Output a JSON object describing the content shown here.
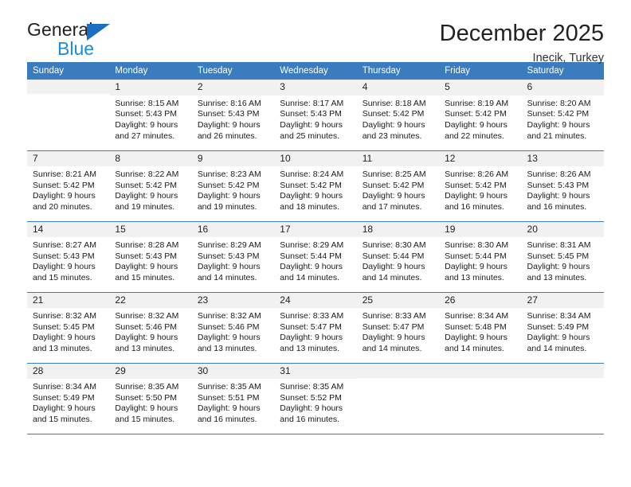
{
  "brand": {
    "word_general": "General",
    "word_blue": "Blue",
    "triangle_color": "#1b6ec2",
    "blue_color": "#1b8cdd"
  },
  "header": {
    "title": "December 2025",
    "location": "Inecik, Turkey"
  },
  "theme": {
    "header_blue": "#3b7cbf",
    "daynum_gray": "#f1f1f1"
  },
  "weekdays": [
    "Sunday",
    "Monday",
    "Tuesday",
    "Wednesday",
    "Thursday",
    "Friday",
    "Saturday"
  ],
  "weeks": [
    [
      {
        "day": "",
        "sunrise": "",
        "sunset": "",
        "daylight1": "",
        "daylight2": ""
      },
      {
        "day": "1",
        "sunrise": "Sunrise: 8:15 AM",
        "sunset": "Sunset: 5:43 PM",
        "daylight1": "Daylight: 9 hours",
        "daylight2": "and 27 minutes."
      },
      {
        "day": "2",
        "sunrise": "Sunrise: 8:16 AM",
        "sunset": "Sunset: 5:43 PM",
        "daylight1": "Daylight: 9 hours",
        "daylight2": "and 26 minutes."
      },
      {
        "day": "3",
        "sunrise": "Sunrise: 8:17 AM",
        "sunset": "Sunset: 5:43 PM",
        "daylight1": "Daylight: 9 hours",
        "daylight2": "and 25 minutes."
      },
      {
        "day": "4",
        "sunrise": "Sunrise: 8:18 AM",
        "sunset": "Sunset: 5:42 PM",
        "daylight1": "Daylight: 9 hours",
        "daylight2": "and 23 minutes."
      },
      {
        "day": "5",
        "sunrise": "Sunrise: 8:19 AM",
        "sunset": "Sunset: 5:42 PM",
        "daylight1": "Daylight: 9 hours",
        "daylight2": "and 22 minutes."
      },
      {
        "day": "6",
        "sunrise": "Sunrise: 8:20 AM",
        "sunset": "Sunset: 5:42 PM",
        "daylight1": "Daylight: 9 hours",
        "daylight2": "and 21 minutes."
      }
    ],
    [
      {
        "day": "7",
        "sunrise": "Sunrise: 8:21 AM",
        "sunset": "Sunset: 5:42 PM",
        "daylight1": "Daylight: 9 hours",
        "daylight2": "and 20 minutes."
      },
      {
        "day": "8",
        "sunrise": "Sunrise: 8:22 AM",
        "sunset": "Sunset: 5:42 PM",
        "daylight1": "Daylight: 9 hours",
        "daylight2": "and 19 minutes."
      },
      {
        "day": "9",
        "sunrise": "Sunrise: 8:23 AM",
        "sunset": "Sunset: 5:42 PM",
        "daylight1": "Daylight: 9 hours",
        "daylight2": "and 19 minutes."
      },
      {
        "day": "10",
        "sunrise": "Sunrise: 8:24 AM",
        "sunset": "Sunset: 5:42 PM",
        "daylight1": "Daylight: 9 hours",
        "daylight2": "and 18 minutes."
      },
      {
        "day": "11",
        "sunrise": "Sunrise: 8:25 AM",
        "sunset": "Sunset: 5:42 PM",
        "daylight1": "Daylight: 9 hours",
        "daylight2": "and 17 minutes."
      },
      {
        "day": "12",
        "sunrise": "Sunrise: 8:26 AM",
        "sunset": "Sunset: 5:42 PM",
        "daylight1": "Daylight: 9 hours",
        "daylight2": "and 16 minutes."
      },
      {
        "day": "13",
        "sunrise": "Sunrise: 8:26 AM",
        "sunset": "Sunset: 5:43 PM",
        "daylight1": "Daylight: 9 hours",
        "daylight2": "and 16 minutes."
      }
    ],
    [
      {
        "day": "14",
        "sunrise": "Sunrise: 8:27 AM",
        "sunset": "Sunset: 5:43 PM",
        "daylight1": "Daylight: 9 hours",
        "daylight2": "and 15 minutes."
      },
      {
        "day": "15",
        "sunrise": "Sunrise: 8:28 AM",
        "sunset": "Sunset: 5:43 PM",
        "daylight1": "Daylight: 9 hours",
        "daylight2": "and 15 minutes."
      },
      {
        "day": "16",
        "sunrise": "Sunrise: 8:29 AM",
        "sunset": "Sunset: 5:43 PM",
        "daylight1": "Daylight: 9 hours",
        "daylight2": "and 14 minutes."
      },
      {
        "day": "17",
        "sunrise": "Sunrise: 8:29 AM",
        "sunset": "Sunset: 5:44 PM",
        "daylight1": "Daylight: 9 hours",
        "daylight2": "and 14 minutes."
      },
      {
        "day": "18",
        "sunrise": "Sunrise: 8:30 AM",
        "sunset": "Sunset: 5:44 PM",
        "daylight1": "Daylight: 9 hours",
        "daylight2": "and 14 minutes."
      },
      {
        "day": "19",
        "sunrise": "Sunrise: 8:30 AM",
        "sunset": "Sunset: 5:44 PM",
        "daylight1": "Daylight: 9 hours",
        "daylight2": "and 13 minutes."
      },
      {
        "day": "20",
        "sunrise": "Sunrise: 8:31 AM",
        "sunset": "Sunset: 5:45 PM",
        "daylight1": "Daylight: 9 hours",
        "daylight2": "and 13 minutes."
      }
    ],
    [
      {
        "day": "21",
        "sunrise": "Sunrise: 8:32 AM",
        "sunset": "Sunset: 5:45 PM",
        "daylight1": "Daylight: 9 hours",
        "daylight2": "and 13 minutes."
      },
      {
        "day": "22",
        "sunrise": "Sunrise: 8:32 AM",
        "sunset": "Sunset: 5:46 PM",
        "daylight1": "Daylight: 9 hours",
        "daylight2": "and 13 minutes."
      },
      {
        "day": "23",
        "sunrise": "Sunrise: 8:32 AM",
        "sunset": "Sunset: 5:46 PM",
        "daylight1": "Daylight: 9 hours",
        "daylight2": "and 13 minutes."
      },
      {
        "day": "24",
        "sunrise": "Sunrise: 8:33 AM",
        "sunset": "Sunset: 5:47 PM",
        "daylight1": "Daylight: 9 hours",
        "daylight2": "and 13 minutes."
      },
      {
        "day": "25",
        "sunrise": "Sunrise: 8:33 AM",
        "sunset": "Sunset: 5:47 PM",
        "daylight1": "Daylight: 9 hours",
        "daylight2": "and 14 minutes."
      },
      {
        "day": "26",
        "sunrise": "Sunrise: 8:34 AM",
        "sunset": "Sunset: 5:48 PM",
        "daylight1": "Daylight: 9 hours",
        "daylight2": "and 14 minutes."
      },
      {
        "day": "27",
        "sunrise": "Sunrise: 8:34 AM",
        "sunset": "Sunset: 5:49 PM",
        "daylight1": "Daylight: 9 hours",
        "daylight2": "and 14 minutes."
      }
    ],
    [
      {
        "day": "28",
        "sunrise": "Sunrise: 8:34 AM",
        "sunset": "Sunset: 5:49 PM",
        "daylight1": "Daylight: 9 hours",
        "daylight2": "and 15 minutes."
      },
      {
        "day": "29",
        "sunrise": "Sunrise: 8:35 AM",
        "sunset": "Sunset: 5:50 PM",
        "daylight1": "Daylight: 9 hours",
        "daylight2": "and 15 minutes."
      },
      {
        "day": "30",
        "sunrise": "Sunrise: 8:35 AM",
        "sunset": "Sunset: 5:51 PM",
        "daylight1": "Daylight: 9 hours",
        "daylight2": "and 16 minutes."
      },
      {
        "day": "31",
        "sunrise": "Sunrise: 8:35 AM",
        "sunset": "Sunset: 5:52 PM",
        "daylight1": "Daylight: 9 hours",
        "daylight2": "and 16 minutes."
      },
      {
        "day": "",
        "sunrise": "",
        "sunset": "",
        "daylight1": "",
        "daylight2": ""
      },
      {
        "day": "",
        "sunrise": "",
        "sunset": "",
        "daylight1": "",
        "daylight2": ""
      },
      {
        "day": "",
        "sunrise": "",
        "sunset": "",
        "daylight1": "",
        "daylight2": ""
      }
    ]
  ]
}
